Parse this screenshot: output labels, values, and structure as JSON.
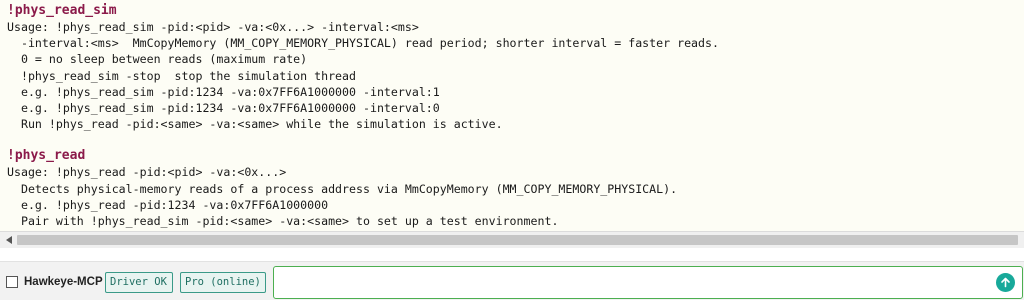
{
  "output": {
    "blocks": [
      {
        "title": "!phys_read_sim",
        "lines": [
          "Usage: !phys_read_sim -pid:<pid> -va:<0x...> -interval:<ms>",
          "  -interval:<ms>  MmCopyMemory (MM_COPY_MEMORY_PHYSICAL) read period; shorter interval = faster reads.",
          "  0 = no sleep between reads (maximum rate)",
          "  !phys_read_sim -stop  stop the simulation thread",
          "  e.g. !phys_read_sim -pid:1234 -va:0x7FF6A1000000 -interval:1",
          "  e.g. !phys_read_sim -pid:1234 -va:0x7FF6A1000000 -interval:0",
          "  Run !phys_read -pid:<same> -va:<same> while the simulation is active."
        ]
      },
      {
        "title": "!phys_read",
        "lines": [
          "Usage: !phys_read -pid:<pid> -va:<0x...>",
          "  Detects physical-memory reads of a process address via MmCopyMemory (MM_COPY_MEMORY_PHYSICAL).",
          "  e.g. !phys_read -pid:1234 -va:0x7FF6A1000000",
          "  Pair with !phys_read_sim -pid:<same> -va:<same> to set up a test environment."
        ]
      }
    ]
  },
  "statusbar": {
    "mcp_label": "Hawkeye-MCP",
    "mcp_checked": false,
    "driver_badge": "Driver OK",
    "pro_badge": "Pro (online)",
    "input_value": "",
    "input_placeholder": ""
  },
  "icons": {
    "scroll_left": "triangle-left-icon",
    "send": "arrow-up-icon"
  },
  "colors": {
    "title": "#8b1a4a",
    "accent": "#18a99a",
    "badge_border": "#3a9a88",
    "input_border": "#4caf50"
  }
}
